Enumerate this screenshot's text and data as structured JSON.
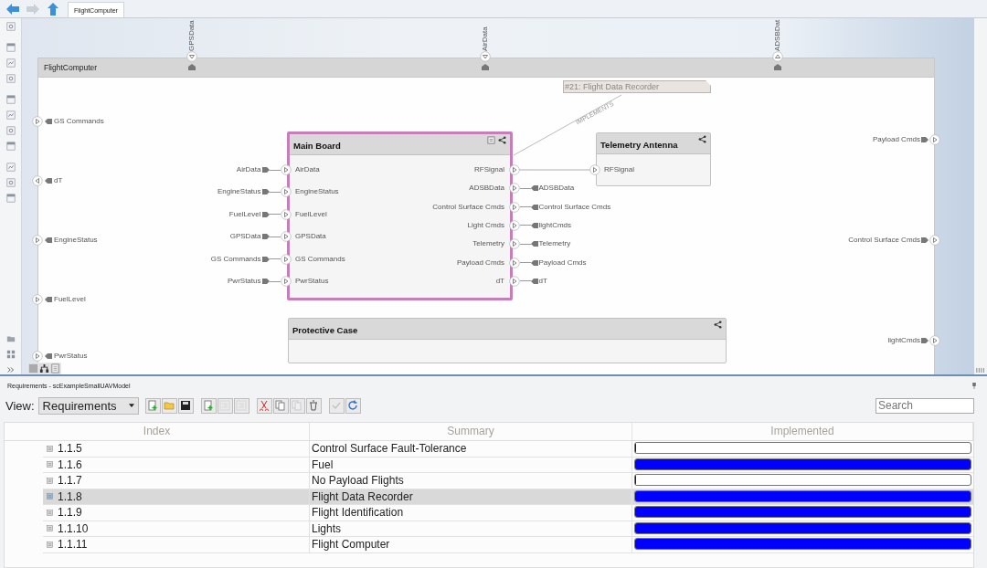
{
  "nav": [
    {
      "kind": "back",
      "disabled": false
    },
    {
      "kind": "forward",
      "disabled": true
    },
    {
      "kind": "up",
      "disabled": false
    }
  ],
  "tab": {
    "label": "FlightComputer"
  },
  "canvas": {
    "frame": {
      "title": "FlightComputer"
    },
    "top_ports": [
      {
        "label": "GPSData",
        "output": false
      },
      {
        "label": "AirData",
        "output": false
      },
      {
        "label": "ADSBDat",
        "output": true
      }
    ],
    "left_ports": [
      {
        "label": "GS Commands",
        "output": false
      },
      {
        "label": "dT",
        "output": true
      },
      {
        "label": "EngineStatus",
        "output": false
      },
      {
        "label": "FuelLevel",
        "output": false
      },
      {
        "label": "PwrStatus",
        "output": false
      }
    ],
    "right_ports": [
      {
        "label": "Payload Cmds",
        "output": true
      },
      {
        "label": "Control Surface Cmds",
        "output": true
      },
      {
        "label": "lightCmds",
        "output": true
      }
    ],
    "components": [
      {
        "title": "Main Board",
        "selected": true,
        "linked_requirement": true,
        "inputs": [
          {
            "label": "AirData",
            "source": "AirData"
          },
          {
            "label": "EngineStatus",
            "source": "EngineStatus"
          },
          {
            "label": "FuelLevel",
            "source": "FuelLevel"
          },
          {
            "label": "GPSData",
            "source": "GPSData"
          },
          {
            "label": "GS Commands",
            "source": "GS Commands"
          },
          {
            "label": "PwrStatus",
            "source": "PwrStatus"
          }
        ],
        "outputs": [
          {
            "label": "RFSignal"
          },
          {
            "label": "ADSBData",
            "target": "ADSBData"
          },
          {
            "label": "Control Surface Cmds",
            "target": "Control Surface Cmds"
          },
          {
            "label": "Light Cmds",
            "target": "lightCmds"
          },
          {
            "label": "Telemetry",
            "target": "Telemetry"
          },
          {
            "label": "Payload Cmds",
            "target": "Payload Cmds"
          },
          {
            "label": "dT",
            "target": "dT"
          }
        ]
      },
      {
        "title": "Telemetry Antenna",
        "selected": false,
        "linked_requirement": false,
        "inputs": [
          {
            "label": "RFSignal"
          }
        ]
      },
      {
        "title": "Protective Case",
        "selected": false,
        "linked_requirement": false
      }
    ],
    "requirement_note": {
      "label": "#21: Flight Data Recorder"
    },
    "connector_label": "IMPLEMENTS"
  },
  "requirements": {
    "title": "Requirements - scExampleSmallUAVModel",
    "view_label": "View:",
    "view": "Requirements",
    "toolbar": [
      {
        "kind": "new",
        "disabled": false
      },
      {
        "kind": "open",
        "disabled": false
      },
      {
        "kind": "save",
        "disabled": false
      },
      {
        "kind": "add",
        "disabled": false
      },
      {
        "kind": "outdent",
        "disabled": true
      },
      {
        "kind": "indent",
        "disabled": true
      },
      {
        "kind": "cut",
        "disabled": false
      },
      {
        "kind": "copy",
        "disabled": false
      },
      {
        "kind": "paste",
        "disabled": true
      },
      {
        "kind": "delete",
        "disabled": false
      },
      {
        "kind": "accept",
        "disabled": true
      },
      {
        "kind": "refresh",
        "disabled": false
      }
    ],
    "search": {
      "placeholder": "Search"
    },
    "columns": [
      "Index",
      "Summary",
      "Implemented"
    ],
    "rows": [
      {
        "index": "1.1.5",
        "summary": "Control Surface Fault-Tolerance",
        "level": 0,
        "selected": false
      },
      {
        "index": "1.1.6",
        "summary": "Fuel",
        "level": 1,
        "selected": false
      },
      {
        "index": "1.1.7",
        "summary": "No Payload Flights",
        "level": 0,
        "selected": false
      },
      {
        "index": "1.1.8",
        "summary": "Flight Data Recorder",
        "level": 1,
        "selected": true
      },
      {
        "index": "1.1.9",
        "summary": "Flight Identification",
        "level": 1,
        "selected": false
      },
      {
        "index": "1.1.10",
        "summary": "Lights",
        "level": 1,
        "selected": false
      },
      {
        "index": "1.1.11",
        "summary": "Flight Computer",
        "level": 1,
        "selected": false
      }
    ]
  }
}
